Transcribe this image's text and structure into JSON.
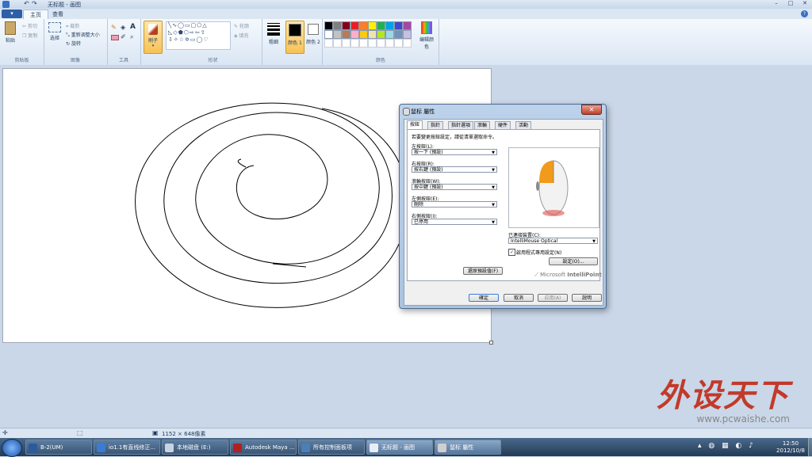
{
  "titlebar": {
    "title": "无标题 - 画图"
  },
  "tabs": [
    {
      "label": "主页"
    },
    {
      "label": "查看"
    }
  ],
  "ribbon": {
    "clipboard": {
      "paste": "粘贴",
      "cut": "剪切",
      "copy": "复制",
      "label": "剪贴板"
    },
    "image": {
      "select": "选择",
      "crop": "裁剪",
      "resize": "重新调整大小",
      "rotate": "旋转",
      "label": "图像"
    },
    "tools": {
      "label": "工具"
    },
    "brushes": {
      "label": "刷子"
    },
    "shapes": {
      "outline": "轮廓",
      "fill": "填充",
      "label": "形状"
    },
    "size": {
      "label": "粗细"
    },
    "color1": {
      "label": "颜色 1"
    },
    "color2": {
      "label": "颜色 2"
    },
    "colors": {
      "label": "颜色",
      "edit": "编辑颜色"
    }
  },
  "palette": [
    "#000000",
    "#7f7f7f",
    "#880015",
    "#ed1c24",
    "#ff7f27",
    "#fff200",
    "#22b14c",
    "#00a2e8",
    "#3f48cc",
    "#a349a4",
    "#ffffff",
    "#c3c3c3",
    "#b97a57",
    "#ffaec9",
    "#ffc90e",
    "#efe4b0",
    "#b5e61d",
    "#99d9ea",
    "#7092be",
    "#c8bfe7"
  ],
  "statusbar": {
    "size": "1152 × 648像素"
  },
  "dialog": {
    "title": "鼠标 屬性",
    "close": "✕",
    "tabs": [
      "按鈕",
      "指針",
      "指針選項",
      "滾輪",
      "硬件",
      "活動"
    ],
    "instruction": "若要變更按鈕設定，請從清單選取命令。",
    "fields": [
      {
        "label": "左按鈕(L):",
        "value": "按一下 (預設)"
      },
      {
        "label": "右按鈕(R):",
        "value": "按右鍵 (預設)"
      },
      {
        "label": "滾輪按鈕(W):",
        "value": "按中鍵 (預設)"
      },
      {
        "label": "左側按鈕(E):",
        "value": "刪除"
      },
      {
        "label": "右側按鈕(I):",
        "value": "已停用"
      }
    ],
    "device_label": "已連接裝置(C):",
    "device_value": "IntelliMouse Optical",
    "checkbox_label": "啟用程式專用設定(N)",
    "settings_btn": "設定(O)...",
    "restore_btn": "還原預設值(F)",
    "brand_prefix": "Microsoft",
    "brand_name": "IntelliPoint",
    "ok": "確定",
    "cancel": "取消",
    "apply": "应用(A)",
    "help": "說明"
  },
  "taskbar": {
    "items": [
      {
        "label": "B-2(UM)",
        "color": "#2a5aa0"
      },
      {
        "label": "io1.1有直线修正...",
        "color": "#3a7bd5"
      },
      {
        "label": "本地磁盘 (E:)",
        "color": "#c9d3df"
      },
      {
        "label": "Autodesk Maya ...",
        "color": "#b02020"
      },
      {
        "label": "所有控制面板项",
        "color": "#4a7fb8"
      },
      {
        "label": "无标题 - 画图",
        "color": "#e8eef6"
      },
      {
        "label": "鼠标 屬性",
        "color": "#d0d0d0"
      }
    ],
    "time": "12:50",
    "date": "2012/10/8"
  },
  "watermark": {
    "title": "外设天下",
    "url": "www.pcwaishe.com"
  }
}
